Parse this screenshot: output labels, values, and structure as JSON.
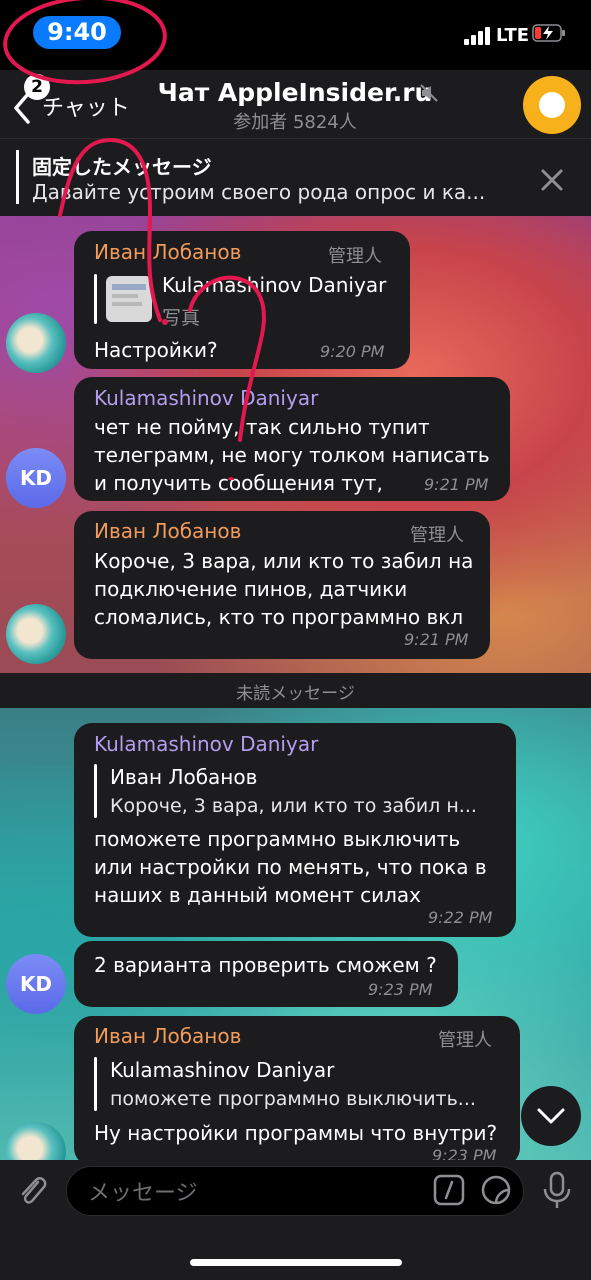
{
  "status_bar": {
    "time": "9:40",
    "network": "LTE"
  },
  "header": {
    "back_label": "チャット",
    "back_badge": "2",
    "title": "Чат AppleInsider.ru",
    "subtitle": "参加者 5824人"
  },
  "pinned": {
    "title": "固定したメッセージ",
    "text": "Давайте устроим своего рода опрос и ка..."
  },
  "messages": [
    {
      "sender": "Иван Лобанов",
      "role": "管理人",
      "quote_name": "Kulamashinov Daniyar",
      "quote_text": "写真",
      "text": "Настройки?",
      "time": "9:20 PM"
    },
    {
      "sender": "Kulamashinov Daniyar",
      "avatar": "KD",
      "lines": [
        "чет не пойму, так сильно тупит",
        "телеграмм, не могу толком написать",
        "и получить сообщения тут,"
      ],
      "time": "9:21 PM"
    },
    {
      "sender": "Иван Лобанов",
      "role": "管理人",
      "lines": [
        "Короче, 3 вара, или кто то забил на",
        "подключение пинов, датчики",
        "сломались, кто то программно вкл"
      ],
      "time": "9:21 PM"
    },
    {
      "sender": "Kulamashinov Daniyar",
      "quote_name": "Иван Лобанов",
      "quote_text": "Короче, 3 вара, или кто то забил н...",
      "lines": [
        "поможете программно выключить",
        "или настройки по менять, что пока в",
        "наших в данный момент силах"
      ],
      "time": "9:22 PM"
    },
    {
      "avatar": "KD",
      "text": "2 варианта проверить сможем ?",
      "time": "9:23 PM"
    },
    {
      "sender": "Иван Лобанов",
      "role": "管理人",
      "quote_name": "Kulamashinov Daniyar",
      "quote_text": "поможете программно выключить...",
      "text": "Ну настройки программы что внутри?",
      "time": "9:23 PM"
    }
  ],
  "unread_divider": "未読メッセージ",
  "input": {
    "placeholder": "メッセージ"
  },
  "colors": {
    "accent_orange": "#f09a5c",
    "accent_purple": "#b39df0",
    "bubble": "#1c1c1e",
    "status_pill": "#0a7aff",
    "chat_avatar": "#f7b21b"
  }
}
